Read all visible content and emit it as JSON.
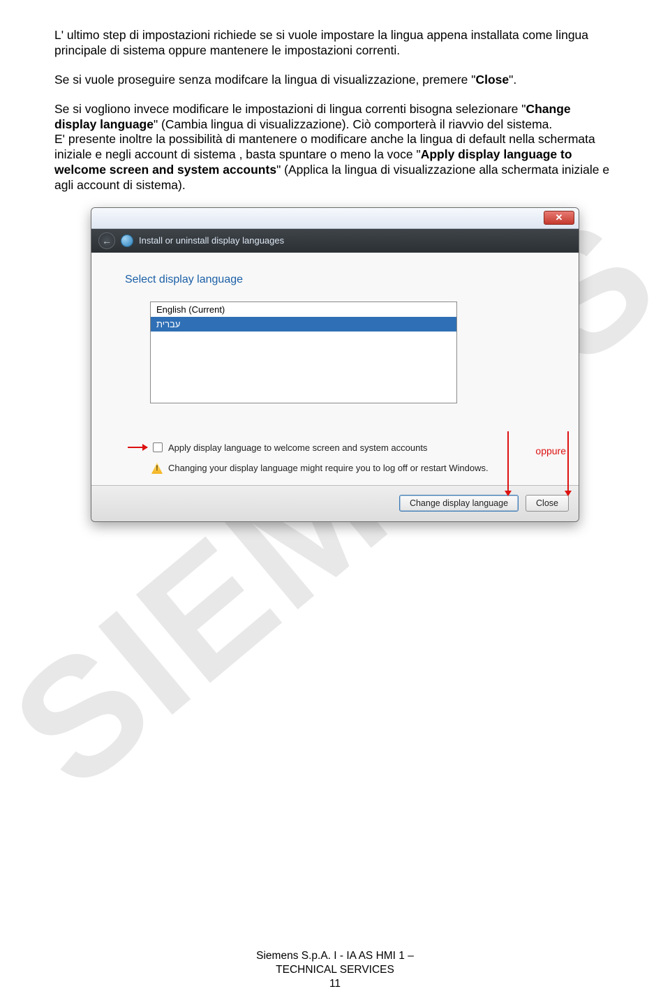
{
  "watermark": "SIEMENS",
  "paragraphs": {
    "p1": "L' ultimo step di impostazioni richiede se si vuole impostare la lingua appena installata come lingua principale di sistema oppure mantenere le impostazioni correnti.",
    "p2_a": "Se si vuole proseguire senza modifcare la lingua di visualizzazione, premere \"",
    "p2_bold": "Close",
    "p2_b": "\".",
    "p3_a": "Se si vogliono invece modificare le impostazioni di lingua correnti bisogna selezionare \"",
    "p3_bold1": "Change display language",
    "p3_b": "\" (Cambia lingua di visualizzazione). Ciò comporterà il riavvio del sistema.",
    "p3_c": "E' presente inoltre la possibilità di mantenere o modificare anche la lingua di default nella schermata iniziale e negli account di sistema , basta spuntare o meno la voce \"",
    "p3_bold2": "Apply display language to welcome screen and system accounts",
    "p3_d": "\" (Applica la lingua di visualizzazione alla schermata iniziale e agli account di sistema)."
  },
  "dialog": {
    "nav_title": "Install or uninstall display languages",
    "section_title": "Select display language",
    "list_items": [
      "English (Current)",
      "עברית"
    ],
    "checkbox_label": "Apply display language to welcome screen and system accounts",
    "warning_text": "Changing your display language might require you to log off or restart Windows.",
    "btn_change": "Change display language",
    "btn_close": "Close",
    "annotation_oppure": "oppure"
  },
  "footer": {
    "line1": "Siemens S.p.A.  I - IA AS HMI 1 –",
    "line2": "TECHNICAL SERVICES",
    "page_no": "11"
  }
}
